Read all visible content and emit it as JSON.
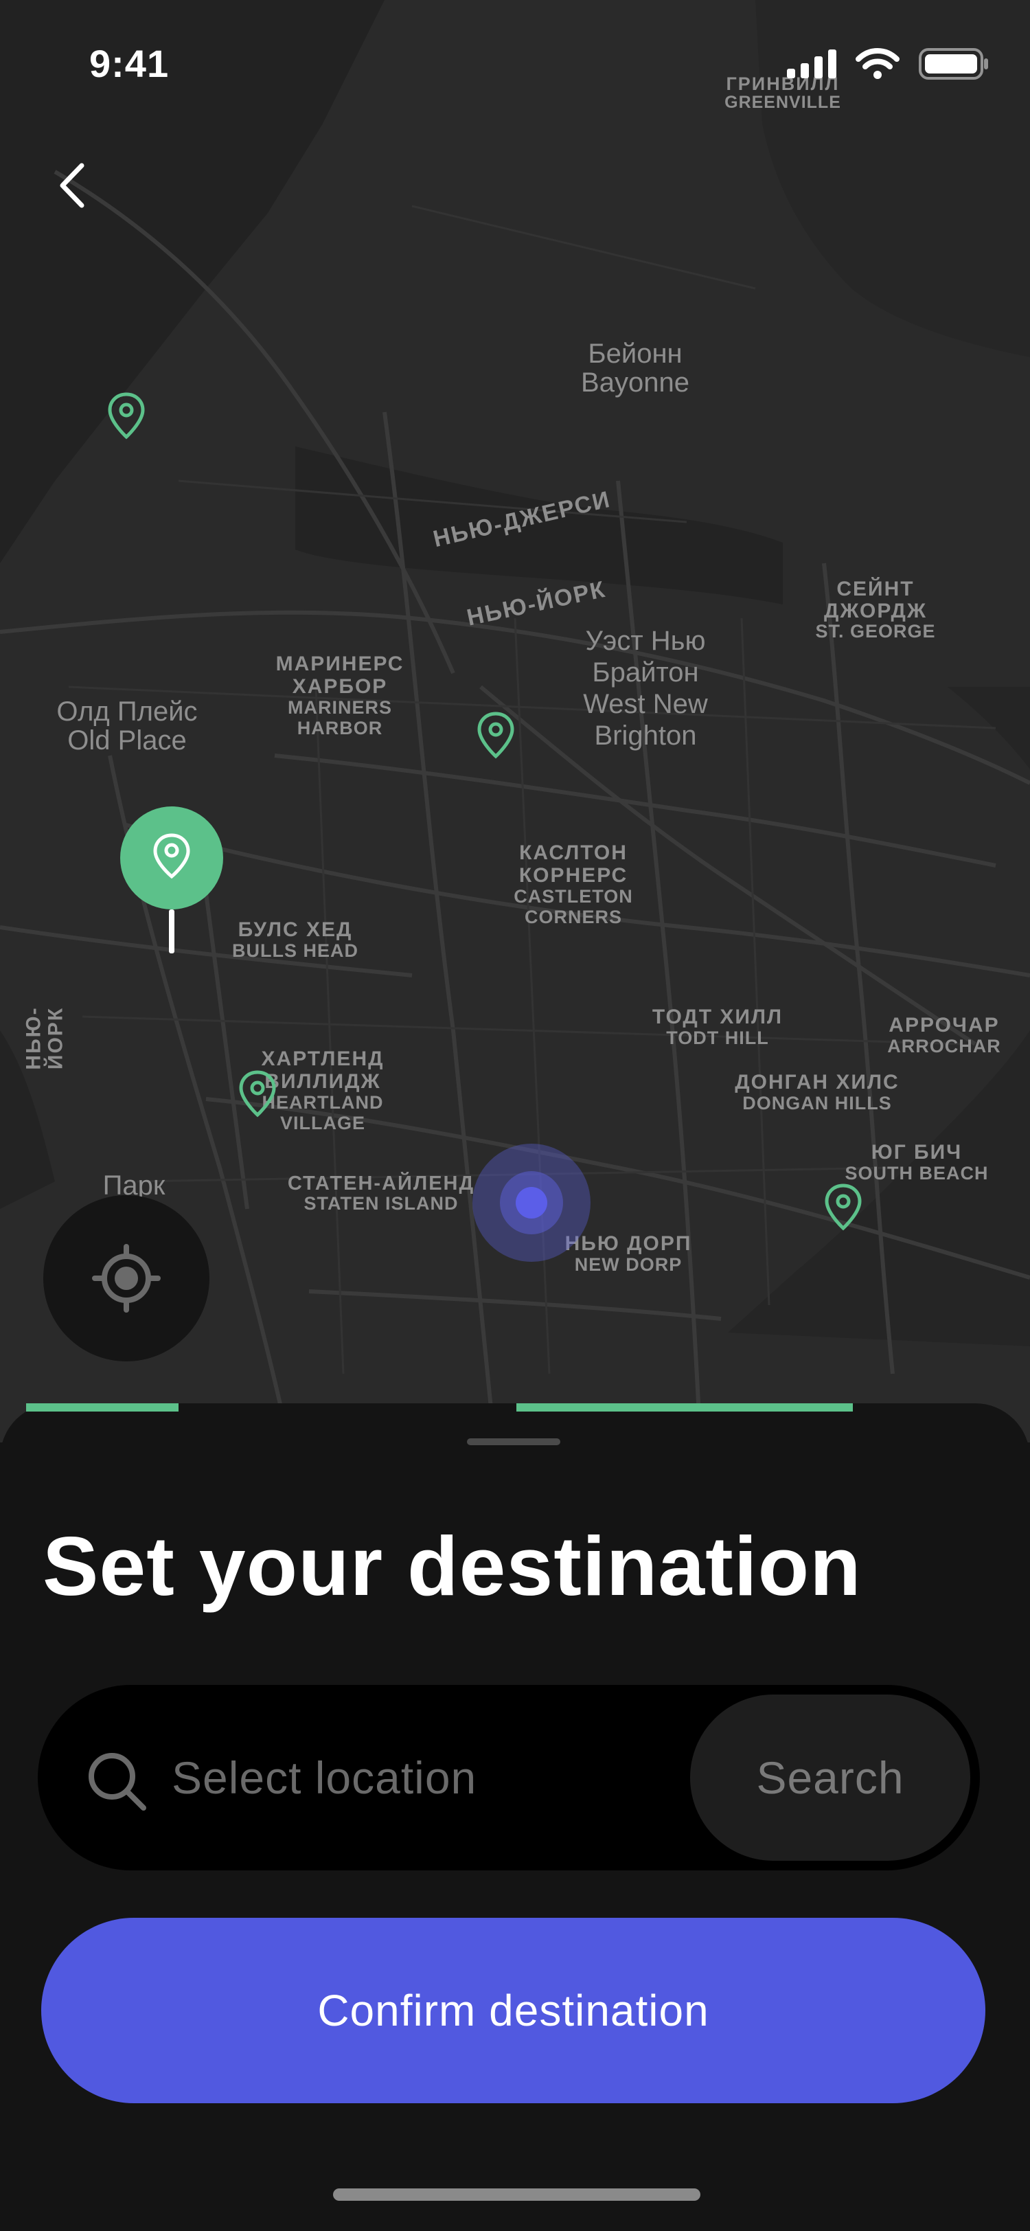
{
  "status_bar": {
    "time": "9:41",
    "icons": [
      "signal-icon",
      "wifi-icon",
      "battery-icon"
    ]
  },
  "navigation": {
    "back_icon": "chevron-left-icon"
  },
  "map": {
    "labels": [
      {
        "id": "greenville",
        "ru": "ГРИНВИЛЛ",
        "en": "GREENVILLE"
      },
      {
        "id": "bayonne",
        "ru": "Бейонн",
        "en": "Bayonne"
      },
      {
        "id": "new-jersey",
        "ru": "НЬЮ-ДЖЕРСИ"
      },
      {
        "id": "new-york",
        "ru": "НЬЮ-ЙОРК"
      },
      {
        "id": "st-george",
        "ru": "СЕЙНТ ДЖОРДЖ",
        "en": "ST. GEORGE"
      },
      {
        "id": "west-brighton",
        "ru": "Уэст Нью Брайтон",
        "en": "West New Brighton"
      },
      {
        "id": "mariners-harbor",
        "ru": "МАРИНЕРС ХАРБОР",
        "en": "MARINERS HARBOR"
      },
      {
        "id": "old-place",
        "ru": "Олд Плейс",
        "en": "Old Place"
      },
      {
        "id": "castleton-corners",
        "ru": "КАСЛТОН КОРНЕРС",
        "en": "CASTLETON CORNERS"
      },
      {
        "id": "bulls-head",
        "ru": "БУЛС ХЕД",
        "en": "BULLS HEAD"
      },
      {
        "id": "new-york-vertical",
        "ru": "НЬЮ-ЙОРК"
      },
      {
        "id": "todt-hill",
        "ru": "ТОДТ ХИЛЛ",
        "en": "TODT HILL"
      },
      {
        "id": "arrochar",
        "ru": "АРРОЧАР",
        "en": "ARROCHAR"
      },
      {
        "id": "heartland-village",
        "ru": "ХАРТЛЕНД ВИЛЛИДЖ",
        "en": "HEARTLAND VILLAGE"
      },
      {
        "id": "dongan-hills",
        "ru": "ДОНГАН ХИЛС",
        "en": "DONGAN HILLS"
      },
      {
        "id": "south-beach",
        "ru": "ЮГ БИЧ",
        "en": "SOUTH BEACH"
      },
      {
        "id": "staten-island",
        "ru": "СТАТЕН-АЙЛЕНД",
        "en": "STATEN ISLAND"
      },
      {
        "id": "new-dorp",
        "ru": "НЬЮ ДОРП",
        "en": "NEW DORP"
      },
      {
        "id": "park",
        "ru": "Парк"
      }
    ],
    "pin_color": "#5cc18a",
    "user_location_color": "#5b5ee8"
  },
  "locate_button": {
    "icon": "locate-target-icon"
  },
  "sheet": {
    "title": "Set your destination",
    "search": {
      "placeholder": "Select location",
      "button_label": "Search",
      "icon": "search-icon"
    },
    "confirm_label": "Confirm destination",
    "accent_color": "#5159e0"
  }
}
